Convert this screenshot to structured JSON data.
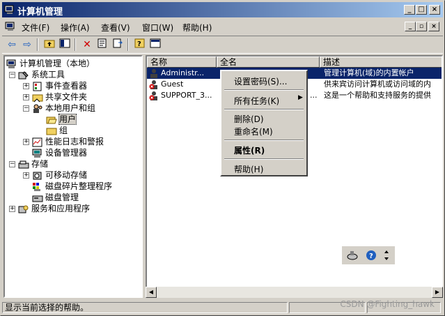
{
  "window": {
    "title": "计算机管理"
  },
  "menubar": {
    "items": [
      "文件(F)",
      "操作(A)",
      "查看(V)",
      "窗口(W)",
      "帮助(H)"
    ]
  },
  "tree": {
    "items": [
      "计算机管理（本地）",
      "系统工具",
      "事件查看器",
      "共享文件夹",
      "本地用户和组",
      "用户",
      "组",
      "性能日志和警报",
      "设备管理器",
      "存储",
      "可移动存储",
      "磁盘碎片整理程序",
      "磁盘管理",
      "服务和应用程序"
    ]
  },
  "list": {
    "columns": [
      "名称",
      "全名",
      "描述"
    ],
    "rows": [
      {
        "name": "Administr...",
        "fullname": "",
        "desc": "管理计算机(域)的内置帐户"
      },
      {
        "name": "Guest",
        "fullname": "",
        "desc": "供来宾访问计算机或访问域的内"
      },
      {
        "name": "SUPPORT_3...",
        "fullname": "...",
        "desc": "这是一个帮助和支持服务的提供"
      }
    ]
  },
  "context_menu": {
    "items": [
      "设置密码(S)...",
      "所有任务(K)",
      "删除(D)",
      "重命名(M)",
      "属性(R)",
      "帮助(H)"
    ]
  },
  "status": {
    "text": "显示当前选择的帮助。"
  },
  "watermark": "CSDN @Fighting_hawk",
  "colors": {
    "title_start": "#0a246a",
    "title_end": "#a6caf0",
    "selection": "#0a246a",
    "face": "#d4d0c8"
  }
}
